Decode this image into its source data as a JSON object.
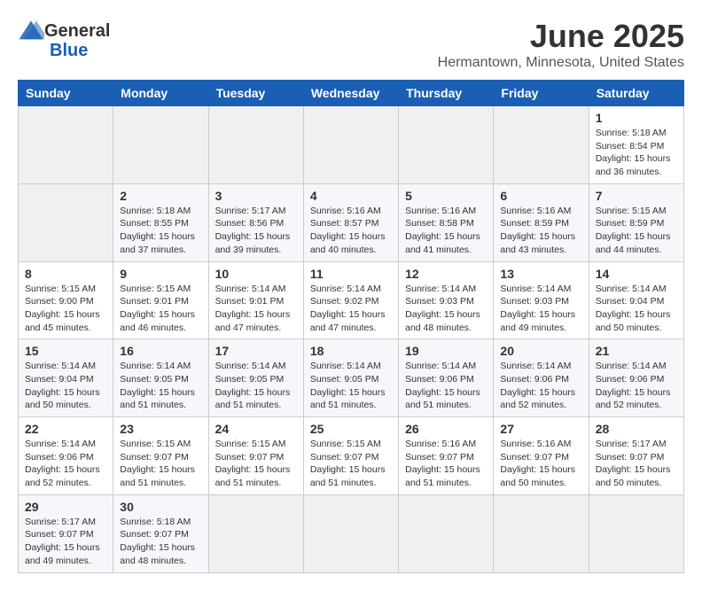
{
  "header": {
    "logo_general": "General",
    "logo_blue": "Blue",
    "month_title": "June 2025",
    "location": "Hermantown, Minnesota, United States"
  },
  "calendar": {
    "days_of_week": [
      "Sunday",
      "Monday",
      "Tuesday",
      "Wednesday",
      "Thursday",
      "Friday",
      "Saturday"
    ],
    "weeks": [
      [
        {
          "day": "",
          "empty": true
        },
        {
          "day": "",
          "empty": true
        },
        {
          "day": "",
          "empty": true
        },
        {
          "day": "",
          "empty": true
        },
        {
          "day": "",
          "empty": true
        },
        {
          "day": "",
          "empty": true
        },
        {
          "day": "1",
          "sunrise": "Sunrise: 5:18 AM",
          "sunset": "Sunset: 8:54 PM",
          "daylight": "Daylight: 15 hours and 36 minutes."
        }
      ],
      [
        {
          "day": "",
          "empty": true
        },
        {
          "day": "2",
          "sunrise": "Sunrise: 5:18 AM",
          "sunset": "Sunset: 8:55 PM",
          "daylight": "Daylight: 15 hours and 37 minutes."
        },
        {
          "day": "3",
          "sunrise": "Sunrise: 5:17 AM",
          "sunset": "Sunset: 8:56 PM",
          "daylight": "Daylight: 15 hours and 39 minutes."
        },
        {
          "day": "4",
          "sunrise": "Sunrise: 5:16 AM",
          "sunset": "Sunset: 8:57 PM",
          "daylight": "Daylight: 15 hours and 40 minutes."
        },
        {
          "day": "5",
          "sunrise": "Sunrise: 5:16 AM",
          "sunset": "Sunset: 8:58 PM",
          "daylight": "Daylight: 15 hours and 41 minutes."
        },
        {
          "day": "6",
          "sunrise": "Sunrise: 5:16 AM",
          "sunset": "Sunset: 8:59 PM",
          "daylight": "Daylight: 15 hours and 43 minutes."
        },
        {
          "day": "7",
          "sunrise": "Sunrise: 5:15 AM",
          "sunset": "Sunset: 8:59 PM",
          "daylight": "Daylight: 15 hours and 44 minutes."
        }
      ],
      [
        {
          "day": "8",
          "sunrise": "Sunrise: 5:15 AM",
          "sunset": "Sunset: 9:00 PM",
          "daylight": "Daylight: 15 hours and 45 minutes."
        },
        {
          "day": "9",
          "sunrise": "Sunrise: 5:15 AM",
          "sunset": "Sunset: 9:01 PM",
          "daylight": "Daylight: 15 hours and 46 minutes."
        },
        {
          "day": "10",
          "sunrise": "Sunrise: 5:14 AM",
          "sunset": "Sunset: 9:01 PM",
          "daylight": "Daylight: 15 hours and 47 minutes."
        },
        {
          "day": "11",
          "sunrise": "Sunrise: 5:14 AM",
          "sunset": "Sunset: 9:02 PM",
          "daylight": "Daylight: 15 hours and 47 minutes."
        },
        {
          "day": "12",
          "sunrise": "Sunrise: 5:14 AM",
          "sunset": "Sunset: 9:03 PM",
          "daylight": "Daylight: 15 hours and 48 minutes."
        },
        {
          "day": "13",
          "sunrise": "Sunrise: 5:14 AM",
          "sunset": "Sunset: 9:03 PM",
          "daylight": "Daylight: 15 hours and 49 minutes."
        },
        {
          "day": "14",
          "sunrise": "Sunrise: 5:14 AM",
          "sunset": "Sunset: 9:04 PM",
          "daylight": "Daylight: 15 hours and 50 minutes."
        }
      ],
      [
        {
          "day": "15",
          "sunrise": "Sunrise: 5:14 AM",
          "sunset": "Sunset: 9:04 PM",
          "daylight": "Daylight: 15 hours and 50 minutes."
        },
        {
          "day": "16",
          "sunrise": "Sunrise: 5:14 AM",
          "sunset": "Sunset: 9:05 PM",
          "daylight": "Daylight: 15 hours and 51 minutes."
        },
        {
          "day": "17",
          "sunrise": "Sunrise: 5:14 AM",
          "sunset": "Sunset: 9:05 PM",
          "daylight": "Daylight: 15 hours and 51 minutes."
        },
        {
          "day": "18",
          "sunrise": "Sunrise: 5:14 AM",
          "sunset": "Sunset: 9:05 PM",
          "daylight": "Daylight: 15 hours and 51 minutes."
        },
        {
          "day": "19",
          "sunrise": "Sunrise: 5:14 AM",
          "sunset": "Sunset: 9:06 PM",
          "daylight": "Daylight: 15 hours and 51 minutes."
        },
        {
          "day": "20",
          "sunrise": "Sunrise: 5:14 AM",
          "sunset": "Sunset: 9:06 PM",
          "daylight": "Daylight: 15 hours and 52 minutes."
        },
        {
          "day": "21",
          "sunrise": "Sunrise: 5:14 AM",
          "sunset": "Sunset: 9:06 PM",
          "daylight": "Daylight: 15 hours and 52 minutes."
        }
      ],
      [
        {
          "day": "22",
          "sunrise": "Sunrise: 5:14 AM",
          "sunset": "Sunset: 9:06 PM",
          "daylight": "Daylight: 15 hours and 52 minutes."
        },
        {
          "day": "23",
          "sunrise": "Sunrise: 5:15 AM",
          "sunset": "Sunset: 9:07 PM",
          "daylight": "Daylight: 15 hours and 51 minutes."
        },
        {
          "day": "24",
          "sunrise": "Sunrise: 5:15 AM",
          "sunset": "Sunset: 9:07 PM",
          "daylight": "Daylight: 15 hours and 51 minutes."
        },
        {
          "day": "25",
          "sunrise": "Sunrise: 5:15 AM",
          "sunset": "Sunset: 9:07 PM",
          "daylight": "Daylight: 15 hours and 51 minutes."
        },
        {
          "day": "26",
          "sunrise": "Sunrise: 5:16 AM",
          "sunset": "Sunset: 9:07 PM",
          "daylight": "Daylight: 15 hours and 51 minutes."
        },
        {
          "day": "27",
          "sunrise": "Sunrise: 5:16 AM",
          "sunset": "Sunset: 9:07 PM",
          "daylight": "Daylight: 15 hours and 50 minutes."
        },
        {
          "day": "28",
          "sunrise": "Sunrise: 5:17 AM",
          "sunset": "Sunset: 9:07 PM",
          "daylight": "Daylight: 15 hours and 50 minutes."
        }
      ],
      [
        {
          "day": "29",
          "sunrise": "Sunrise: 5:17 AM",
          "sunset": "Sunset: 9:07 PM",
          "daylight": "Daylight: 15 hours and 49 minutes."
        },
        {
          "day": "30",
          "sunrise": "Sunrise: 5:18 AM",
          "sunset": "Sunset: 9:07 PM",
          "daylight": "Daylight: 15 hours and 48 minutes."
        },
        {
          "day": "",
          "empty": true
        },
        {
          "day": "",
          "empty": true
        },
        {
          "day": "",
          "empty": true
        },
        {
          "day": "",
          "empty": true
        },
        {
          "day": "",
          "empty": true
        }
      ]
    ]
  }
}
